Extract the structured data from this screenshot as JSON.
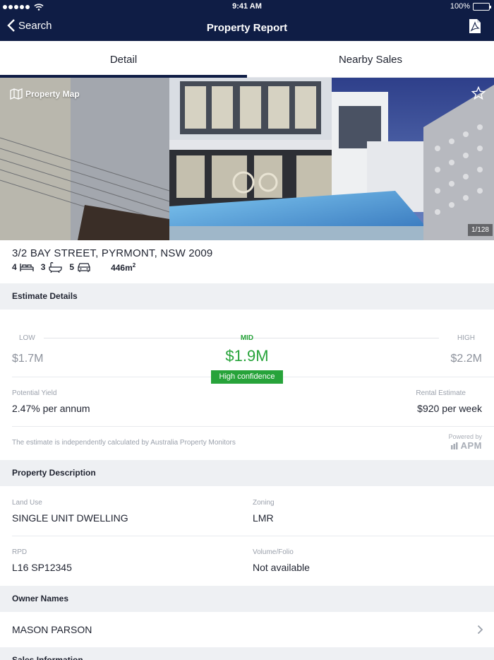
{
  "status_bar": {
    "time": "9:41 AM",
    "battery": "100%"
  },
  "nav": {
    "back_label": "Search",
    "title": "Property Report"
  },
  "tabs": [
    {
      "label": "Detail",
      "active": true
    },
    {
      "label": "Nearby Sales",
      "active": false
    }
  ],
  "hero": {
    "map_label": "Property Map",
    "photo_counter": "1/128"
  },
  "property": {
    "address": "3/2 BAY STREET, PYRMONT, NSW 2009",
    "beds": "4",
    "baths": "3",
    "cars": "5",
    "land_area": "446m",
    "land_area_unit_sup": "2"
  },
  "estimate": {
    "section_title": "Estimate Details",
    "low_label": "LOW",
    "low_value": "$1.7M",
    "mid_label": "MID",
    "mid_value": "$1.9M",
    "high_label": "HIGH",
    "high_value": "$2.2M",
    "confidence": "High confidence",
    "yield_label": "Potential Yield",
    "yield_value": "2.47% per annum",
    "rental_label": "Rental Estimate",
    "rental_value": "$920 per week",
    "disclaimer": "The estimate is independently calculated by Australia Property Monitors",
    "powered_by": "Powered by",
    "powered_brand": "APM"
  },
  "description": {
    "section_title": "Property Description",
    "land_use_label": "Land Use",
    "land_use_value": "SINGLE UNIT DWELLING",
    "zoning_label": "Zoning",
    "zoning_value": "LMR",
    "rpd_label": "RPD",
    "rpd_value": "L16 SP12345",
    "volume_label": "Volume/Folio",
    "volume_value": "Not available"
  },
  "owners": {
    "section_title": "Owner Names",
    "name": "MASON PARSON"
  },
  "next_section": {
    "title": "Sales Information"
  },
  "colors": {
    "navy": "#0f1d45",
    "green": "#27a33a",
    "section_bg": "#eef0f3"
  }
}
